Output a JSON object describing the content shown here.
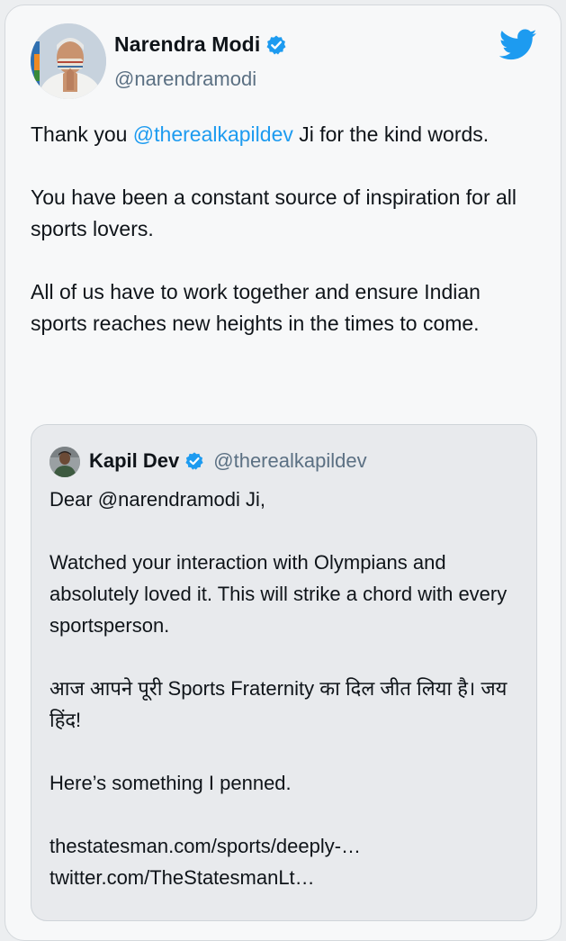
{
  "author": {
    "name": "Narendra Modi",
    "handle": "@narendramodi"
  },
  "tweet": {
    "line1_prefix": "Thank you ",
    "line1_mention": "@therealkapildev",
    "line1_suffix": " Ji for the kind words.",
    "para2": "You have been a constant source of inspiration for all sports lovers.",
    "para3": "All of us have to work together and ensure Indian sports reaches new heights in the times to come."
  },
  "quoted": {
    "name": "Kapil Dev",
    "handle": "@therealkapildev",
    "greeting": "Dear @narendramodi Ji,",
    "para1": "Watched your interaction with Olympians and absolutely loved it. This will strike a chord with every sportsperson.",
    "para2": "आज आपने पूरी Sports Fraternity का दिल जीत लिया है। जय हिंद!",
    "para3": "Here’s something I penned.",
    "link1": "thestatesman.com/sports/deeply-…",
    "link2": "twitter.com/TheStatesmanLt…"
  },
  "icons": {
    "verified": "verified-badge-icon",
    "brand": "twitter-bird-icon"
  },
  "colors": {
    "accent": "#1d9bf0",
    "text": "#0f1419",
    "muted": "#5b7083",
    "card_bg": "#f7f8f9",
    "quote_bg": "#e8eaed"
  }
}
